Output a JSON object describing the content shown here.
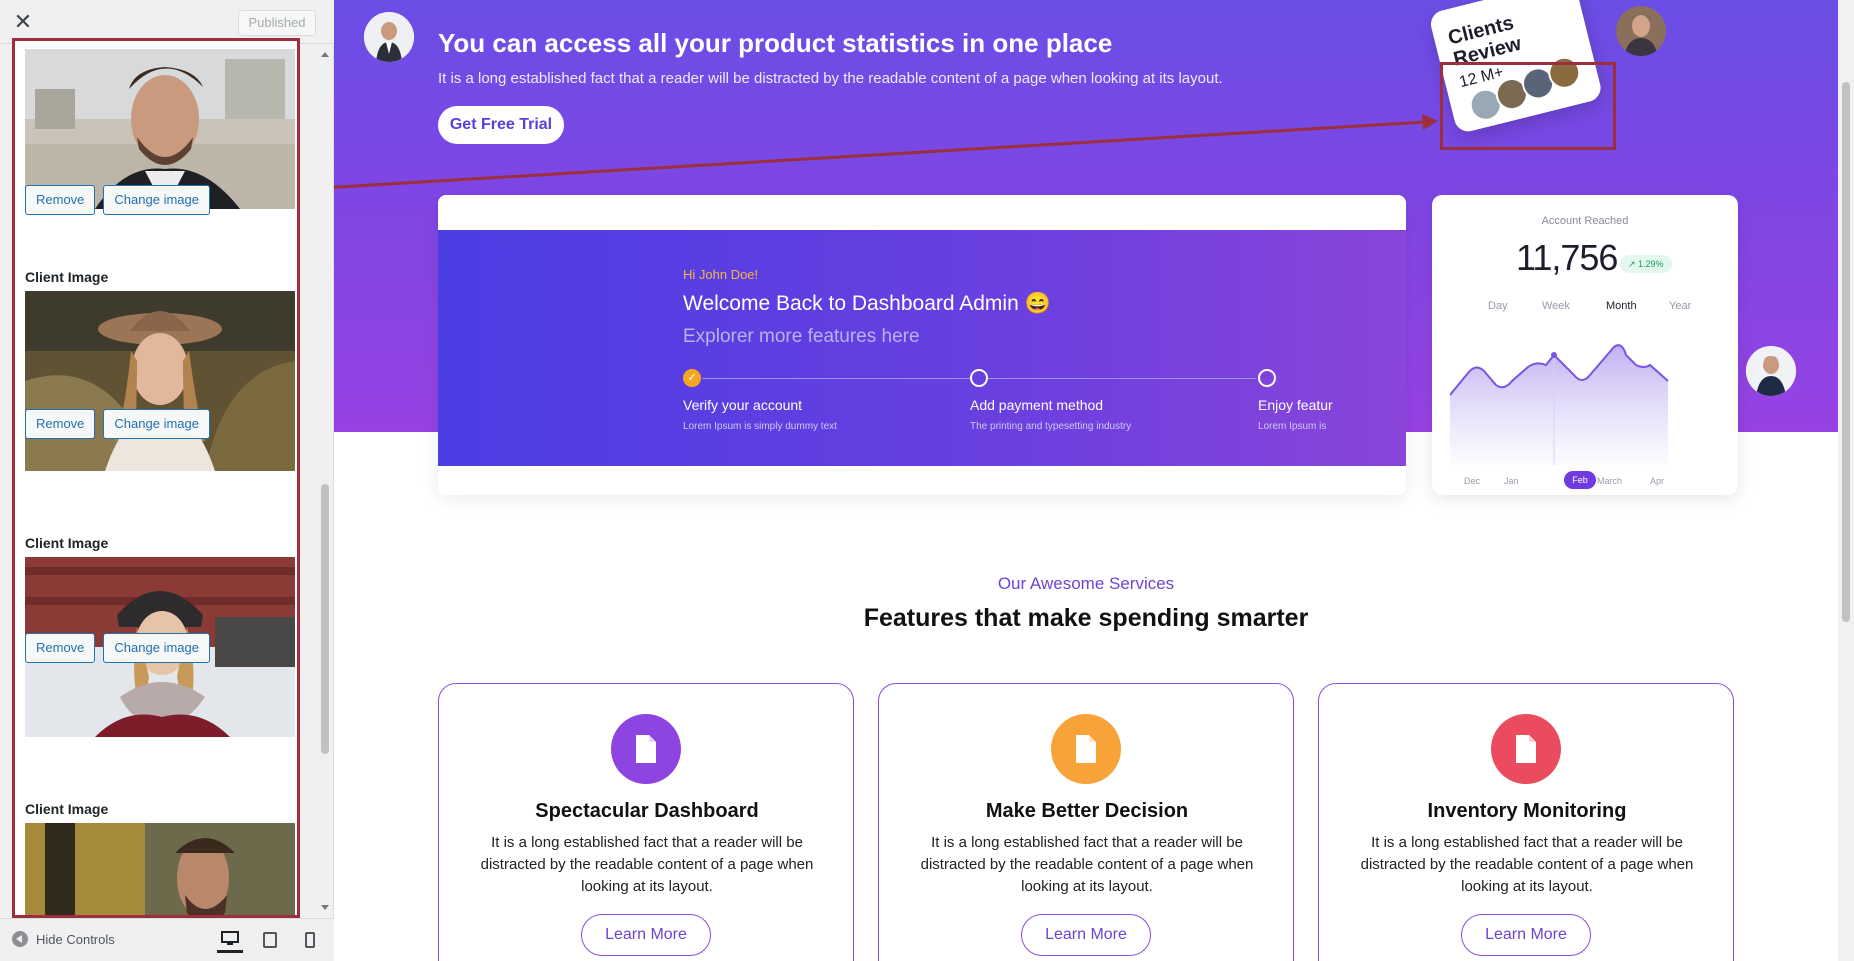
{
  "customizer": {
    "close_glyph": "✕",
    "publish_label": "Published",
    "client_image_label": "Client Image",
    "remove_label": "Remove",
    "change_label": "Change image",
    "footer": {
      "hide_controls_label": "Hide Controls"
    },
    "panel_border_color": "#9c2f3b"
  },
  "hero": {
    "title": "You can access all your product statistics in one place",
    "subtitle": "It is a long established fact that a reader will be distracted by the readable content of a page when looking at its layout.",
    "cta_label": "Get Free Trial",
    "reviews": {
      "title": "Clients Review",
      "count": "12 M+"
    },
    "colors": {
      "gradient_start": "#6b4ee6",
      "gradient_end": "#9742e3"
    }
  },
  "dashboard": {
    "greeting": "Hi John Doe!",
    "welcome": "Welcome Back to Dashboard Admin 😄",
    "explore": "Explorer more features here",
    "steps": [
      {
        "title": "Verify your account",
        "desc": "Lorem Ipsum is simply dummy text",
        "done": true
      },
      {
        "title": "Add payment method",
        "desc": "The printing and typesetting industry",
        "done": false
      },
      {
        "title": "Enjoy featur",
        "desc": "Lorem Ipsum is",
        "done": false
      }
    ]
  },
  "stats": {
    "label": "Account Reached",
    "value": "11,756",
    "badge": "↗ 1.29%",
    "tabs": [
      "Day",
      "Week",
      "Month",
      "Year"
    ],
    "active_tab": "Month",
    "months": [
      "Dec",
      "Jan",
      "Feb",
      "March",
      "Apr"
    ],
    "active_month": "Feb"
  },
  "services": {
    "kicker": "Our Awesome Services",
    "title": "Features that make spending smarter",
    "cards": [
      {
        "title": "Spectacular Dashboard",
        "desc": "It is a long established fact that a reader will be distracted by the readable content of a page when looking at its layout.",
        "button": "Learn More",
        "icon": "document-icon",
        "color": "#8e44e0"
      },
      {
        "title": "Make Better Decision",
        "desc": "It is a long established fact that a reader will be distracted by the readable content of a page when looking at its layout.",
        "button": "Learn More",
        "icon": "document-icon",
        "color": "#f8a23a"
      },
      {
        "title": "Inventory Monitoring",
        "desc": "It is a long established fact that a reader will be distracted by the readable content of a page when looking at its layout.",
        "button": "Learn More",
        "icon": "document-icon",
        "color": "#eb4b5e"
      }
    ]
  }
}
